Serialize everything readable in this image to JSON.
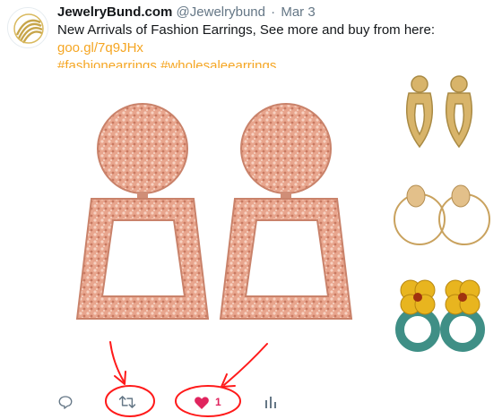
{
  "tweet": {
    "display_name": "JewelryBund.com",
    "handle": "@Jewelrybund",
    "separator": "·",
    "date": "Mar 3",
    "text": "New Arrivals of Fashion Earrings, See more and buy from here: ",
    "link": "goo.gl/7q9JHx",
    "hashtags": [
      "#fashionearrings",
      "#wholesaleearrings"
    ]
  },
  "actions": {
    "reply_icon": "reply-icon",
    "retweet_icon": "retweet-icon",
    "like_icon": "heart-icon",
    "like_count": "1",
    "analytics_icon": "analytics-icon"
  },
  "colors": {
    "accent": "#f5a623",
    "text": "#14171a",
    "muted": "#657786",
    "like": "#e0245e",
    "annotation": "#ff1a1a"
  }
}
